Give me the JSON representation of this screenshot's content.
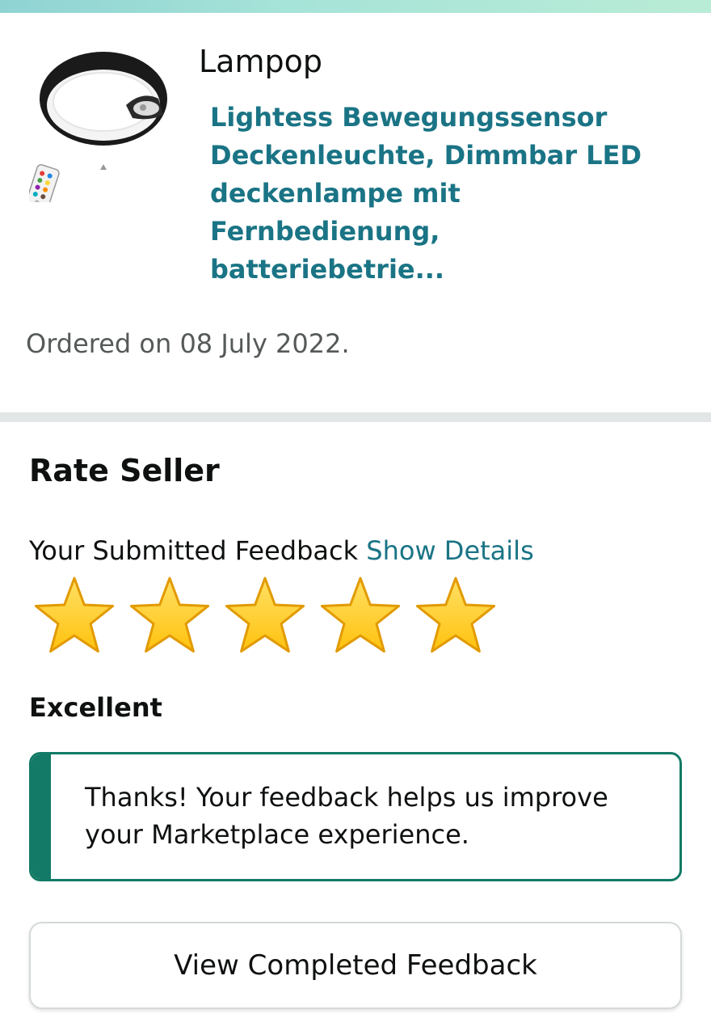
{
  "product": {
    "seller_name": "Lampop",
    "title": "Lightess Bewegungssensor Deckenleuchte, Dimmbar LED deckenlampe mit Fernbedienung, batteriebetrie...",
    "order_date": "Ordered on 08 July 2022.",
    "image_icon": "ceiling-lamp-with-remote"
  },
  "rate_seller": {
    "title": "Rate Seller",
    "submitted_label": "Your Submitted Feedback",
    "show_details_label": "Show Details",
    "rating": 5,
    "max_rating": 5,
    "rating_text": "Excellent",
    "star_icon": "star-filled",
    "thanks_message": "Thanks! Your feedback helps us improve your Marketplace experience.",
    "view_button_label": "View Completed Feedback"
  },
  "colors": {
    "link": "#1a7485",
    "success_border": "#127a66",
    "divider": "#e3e6e6",
    "star_fill": "#ffc20e",
    "star_stroke": "#e29a00"
  }
}
